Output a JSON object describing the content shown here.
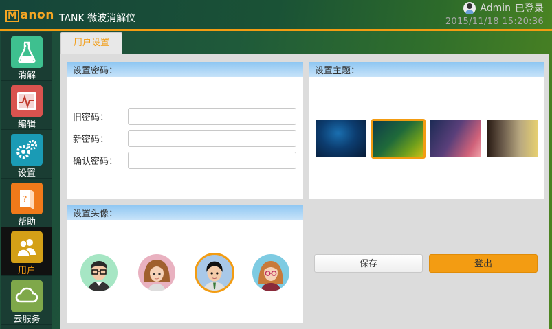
{
  "header": {
    "logo_text": "anon",
    "logo_initial": "M",
    "app_title": "TANK 微波消解仪",
    "user_name": "Admin",
    "login_status": "已登录",
    "datetime": "2015/11/18 15:20:36"
  },
  "sidebar": {
    "items": [
      {
        "label": "消解",
        "icon": "flask-icon",
        "color": "#3ec08f"
      },
      {
        "label": "编辑",
        "icon": "chart-edit-icon",
        "color": "#d9534f"
      },
      {
        "label": "设置",
        "icon": "gears-icon",
        "color": "#1a9bb5"
      },
      {
        "label": "帮助",
        "icon": "help-book-icon",
        "color": "#f07a1a"
      },
      {
        "label": "用户",
        "icon": "users-icon",
        "color": "#d4a017"
      },
      {
        "label": "云服务",
        "icon": "cloud-icon",
        "color": "#7fa84a"
      }
    ],
    "active_index": 4
  },
  "tab": {
    "label": "用户设置"
  },
  "password_card": {
    "title": "设置密码：",
    "old_label": "旧密码：",
    "new_label": "新密码：",
    "confirm_label": "确认密码：",
    "old_value": "",
    "new_value": "",
    "confirm_value": ""
  },
  "theme_card": {
    "title": "设置主题：",
    "themes": [
      "deep-blue",
      "green-yellow",
      "navy-pink",
      "brown-gold"
    ],
    "selected_index": 1
  },
  "avatar_card": {
    "title": "设置头像：",
    "selected_index": 2
  },
  "buttons": {
    "save": "保存",
    "logout": "登出"
  },
  "colors": {
    "accent": "#f39c12",
    "card_header": "#8ec6f2"
  }
}
